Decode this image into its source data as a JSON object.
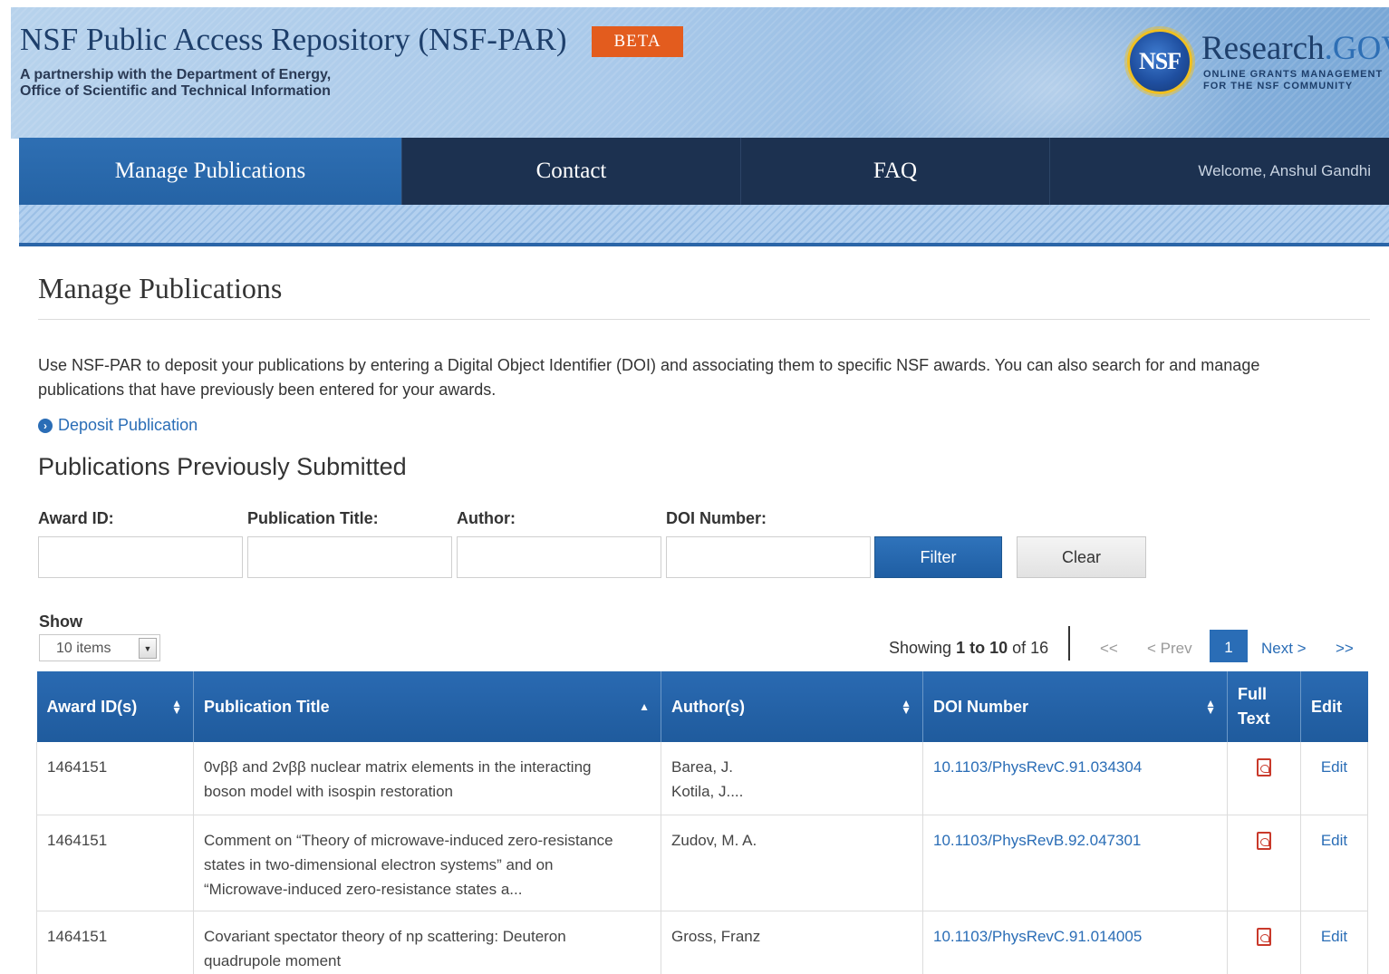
{
  "header": {
    "site_title": "NSF Public Access Repository (NSF-PAR)",
    "badge": "BETA",
    "subtitle_line1": "A partnership with the Department of Energy,",
    "subtitle_line2": "Office of Scientific and Technical Information",
    "logo": {
      "seal_text": "NSF",
      "brand": "Research",
      "brand_suffix": ".GOV",
      "tagline_line1": "ONLINE GRANTS MANAGEMENT",
      "tagline_line2": "FOR THE NSF COMMUNITY"
    }
  },
  "nav": {
    "items": [
      {
        "label": "Manage Publications"
      },
      {
        "label": "Contact"
      },
      {
        "label": "FAQ"
      }
    ],
    "welcome": "Welcome, Anshul Gandhi"
  },
  "main": {
    "title": "Manage Publications",
    "intro": "Use NSF-PAR to deposit your publications by entering a Digital Object Identifier (DOI) and associating them to specific NSF awards. You can also search for and manage publications that have previously been entered for your awards.",
    "deposit_link": "Deposit Publication",
    "section_title": "Publications Previously Submitted",
    "filters": {
      "award_id_label": "Award ID:",
      "title_label": "Publication Title:",
      "author_label": "Author:",
      "doi_label": "DOI Number:",
      "award_id_value": "",
      "title_value": "",
      "author_value": "",
      "doi_value": "",
      "filter_button": "Filter",
      "clear_button": "Clear"
    },
    "show": {
      "label": "Show",
      "selected": "10 items"
    },
    "pagination": {
      "showing_prefix": "Showing ",
      "range": "1 to 10",
      "of_text": " of 16",
      "first": "<<",
      "prev": "< Prev",
      "current": "1",
      "next": "Next >",
      "last": ">>"
    },
    "table": {
      "headers": {
        "award": "Award ID(s)",
        "title": "Publication Title",
        "authors": "Author(s)",
        "doi": "DOI Number",
        "full_text_1": "Full",
        "full_text_2": "Text",
        "edit": "Edit"
      },
      "rows": [
        {
          "award": "1464151",
          "title_line1": "0vββ and 2vββ nuclear matrix elements in the interacting",
          "title_line2": "boson model with isospin restoration",
          "title_line3": "",
          "author_line1": "Barea, J.",
          "author_line2": "Kotila, J....",
          "doi": "10.1103/PhysRevC.91.034304",
          "edit": "Edit"
        },
        {
          "award": "1464151",
          "title_line1": "Comment on “Theory of microwave-induced zero-resistance",
          "title_line2": "states in two-dimensional electron systems” and on",
          "title_line3": "“Microwave-induced zero-resistance states a...",
          "author_line1": "Zudov, M. A.",
          "author_line2": "",
          "doi": "10.1103/PhysRevB.92.047301",
          "edit": "Edit"
        },
        {
          "award": "1464151",
          "title_line1": "Covariant spectator theory of np scattering: Deuteron",
          "title_line2": "quadrupole moment",
          "title_line3": "",
          "author_line1": "Gross, Franz",
          "author_line2": "",
          "doi": "10.1103/PhysRevC.91.014005",
          "edit": "Edit"
        }
      ]
    }
  }
}
